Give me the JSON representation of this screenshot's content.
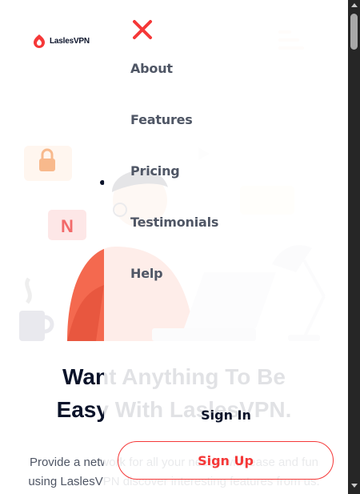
{
  "brand": {
    "name_prefix": "Lasles",
    "name_suffix": "VPN"
  },
  "hero": {
    "title_line1": "Want Anything To Be",
    "title_line2": "Easy With LaslesVPN.",
    "description_line1": "Provide a network for all your needs with ease and fun",
    "description_line2": "using LaslesVPN discover interesting features from us."
  },
  "menu": {
    "items": [
      {
        "label": "About"
      },
      {
        "label": "Features"
      },
      {
        "label": "Pricing"
      },
      {
        "label": "Testimonials"
      },
      {
        "label": "Help"
      }
    ],
    "sign_in": "Sign In",
    "sign_up": "Sign Up"
  },
  "colors": {
    "accent": "#f53838",
    "text_dark": "#0b132a",
    "text_muted": "#4f5665",
    "scrollbar": "#262626"
  },
  "icons": [
    "logo-icon",
    "hamburger-icon",
    "close-icon"
  ]
}
